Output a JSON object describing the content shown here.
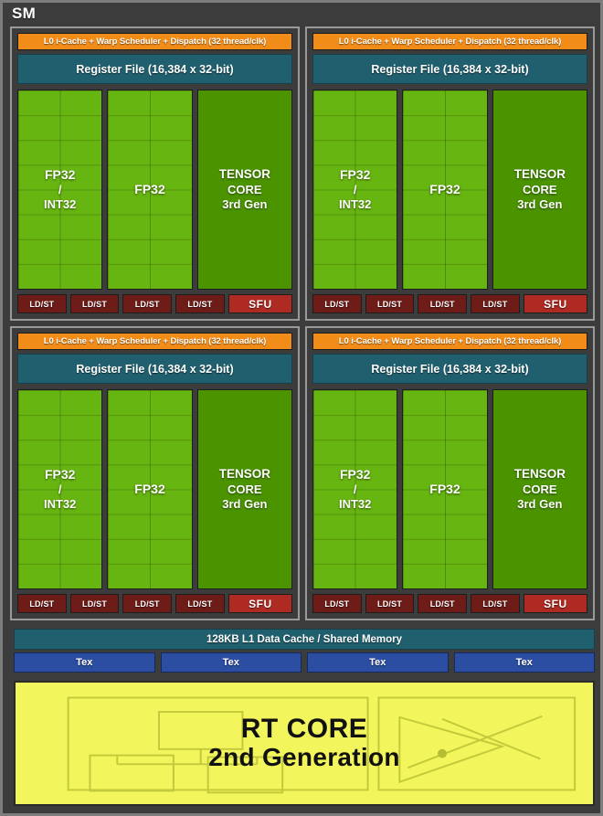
{
  "diagram": {
    "title": "SM",
    "background_color": "#3c3c3c",
    "frame_color": "#7d7d7d"
  },
  "processing_blocks": [
    {
      "scheduler": "L0 i-Cache + Warp Scheduler + Dispatch (32 thread/clk)",
      "register_file": "Register File (16,384 x 32-bit)",
      "cores": [
        {
          "label": "FP32",
          "sub": "/",
          "sub2": "INT32",
          "color": "#67b511"
        },
        {
          "label": "FP32",
          "color": "#67b511"
        },
        {
          "label": "TENSOR",
          "sub": "CORE",
          "sub2": "3rd Gen",
          "color": "#4b9400"
        }
      ],
      "ldst": [
        "LD/ST",
        "LD/ST",
        "LD/ST",
        "LD/ST"
      ],
      "sfu": "SFU"
    },
    {
      "scheduler": "L0 i-Cache + Warp Scheduler + Dispatch (32 thread/clk)",
      "register_file": "Register File (16,384 x 32-bit)",
      "cores": [
        {
          "label": "FP32",
          "sub": "/",
          "sub2": "INT32",
          "color": "#67b511"
        },
        {
          "label": "FP32",
          "color": "#67b511"
        },
        {
          "label": "TENSOR",
          "sub": "CORE",
          "sub2": "3rd Gen",
          "color": "#4b9400"
        }
      ],
      "ldst": [
        "LD/ST",
        "LD/ST",
        "LD/ST",
        "LD/ST"
      ],
      "sfu": "SFU"
    },
    {
      "scheduler": "L0 i-Cache + Warp Scheduler + Dispatch (32 thread/clk)",
      "register_file": "Register File (16,384 x 32-bit)",
      "cores": [
        {
          "label": "FP32",
          "sub": "/",
          "sub2": "INT32",
          "color": "#67b511"
        },
        {
          "label": "FP32",
          "color": "#67b511"
        },
        {
          "label": "TENSOR",
          "sub": "CORE",
          "sub2": "3rd Gen",
          "color": "#4b9400"
        }
      ],
      "ldst": [
        "LD/ST",
        "LD/ST",
        "LD/ST",
        "LD/ST"
      ],
      "sfu": "SFU"
    },
    {
      "scheduler": "L0 i-Cache + Warp Scheduler + Dispatch (32 thread/clk)",
      "register_file": "Register File (16,384 x 32-bit)",
      "cores": [
        {
          "label": "FP32",
          "sub": "/",
          "sub2": "INT32",
          "color": "#67b511"
        },
        {
          "label": "FP32",
          "color": "#67b511"
        },
        {
          "label": "TENSOR",
          "sub": "CORE",
          "sub2": "3rd Gen",
          "color": "#4b9400"
        }
      ],
      "ldst": [
        "LD/ST",
        "LD/ST",
        "LD/ST",
        "LD/ST"
      ],
      "sfu": "SFU"
    }
  ],
  "l1_cache": {
    "label": "128KB L1 Data Cache / Shared Memory",
    "color": "#1f5f6e"
  },
  "texture_units": {
    "color": "#2b4ea3",
    "items": [
      "Tex",
      "Tex",
      "Tex",
      "Tex"
    ]
  },
  "rt_core": {
    "line1": "RT CORE",
    "line2": "2nd Generation",
    "color": "#f2f55c",
    "icon_left": "bvh-tree-icon",
    "icon_right": "ray-triangle-intersection-icon"
  },
  "colors": {
    "scheduler_orange": "#f28c18",
    "register_file_teal": "#1f5f6e",
    "fp32_green": "#67b511",
    "tensor_green": "#4b9400",
    "ldst_maroon": "#6e1c18",
    "sfu_red": "#ae2a22",
    "tex_blue": "#2b4ea3",
    "rt_yellow": "#f2f55c"
  }
}
